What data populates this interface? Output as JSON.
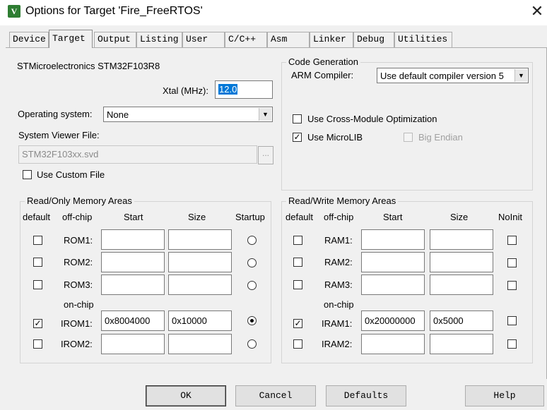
{
  "window": {
    "title": "Options for Target 'Fire_FreeRTOS'",
    "app_icon_glyph": "V"
  },
  "tabs": [
    "Device",
    "Target",
    "Output",
    "Listing",
    "User",
    "C/C++",
    "Asm",
    "Linker",
    "Debug",
    "Utilities"
  ],
  "device_name": "STMicroelectronics STM32F103R8",
  "xtal": {
    "label": "Xtal (MHz):",
    "value": "12.0"
  },
  "os": {
    "label": "Operating system:",
    "value": "None"
  },
  "svd": {
    "label": "System Viewer File:",
    "value": "STM32F103xx.svd",
    "browse": "..."
  },
  "custom_file": {
    "label": "Use Custom File",
    "checked": false
  },
  "code_gen": {
    "title": "Code Generation",
    "compiler_label": "ARM Compiler:",
    "compiler_value": "Use default compiler version 5",
    "cross_module": "Use Cross-Module Optimization",
    "microlib": "Use MicroLIB",
    "big_endian": "Big Endian"
  },
  "rom": {
    "title": "Read/Only Memory Areas",
    "headers": {
      "default": "default",
      "offchip": "off-chip",
      "start": "Start",
      "size": "Size",
      "extra": "Startup"
    },
    "onchip_label": "on-chip",
    "rows": [
      {
        "label": "ROM1:",
        "start": "",
        "size": "",
        "default": false,
        "startup": false
      },
      {
        "label": "ROM2:",
        "start": "",
        "size": "",
        "default": false,
        "startup": false
      },
      {
        "label": "ROM3:",
        "start": "",
        "size": "",
        "default": false,
        "startup": false
      },
      {
        "label": "IROM1:",
        "start": "0x8004000",
        "size": "0x10000",
        "default": true,
        "startup": true
      },
      {
        "label": "IROM2:",
        "start": "",
        "size": "",
        "default": false,
        "startup": false
      }
    ]
  },
  "ram": {
    "title": "Read/Write Memory Areas",
    "headers": {
      "default": "default",
      "offchip": "off-chip",
      "start": "Start",
      "size": "Size",
      "extra": "NoInit"
    },
    "onchip_label": "on-chip",
    "rows": [
      {
        "label": "RAM1:",
        "start": "",
        "size": "",
        "default": false,
        "noinit": false
      },
      {
        "label": "RAM2:",
        "start": "",
        "size": "",
        "default": false,
        "noinit": false
      },
      {
        "label": "RAM3:",
        "start": "",
        "size": "",
        "default": false,
        "noinit": false
      },
      {
        "label": "IRAM1:",
        "start": "0x20000000",
        "size": "0x5000",
        "default": true,
        "noinit": false
      },
      {
        "label": "IRAM2:",
        "start": "",
        "size": "",
        "default": false,
        "noinit": false
      }
    ]
  },
  "buttons": {
    "ok": "OK",
    "cancel": "Cancel",
    "defaults": "Defaults",
    "help": "Help"
  },
  "check_glyph": "✓",
  "icons": {
    "close": "close-icon",
    "dropdown": "chevron-down-icon",
    "app": "keil-uvision-icon"
  }
}
